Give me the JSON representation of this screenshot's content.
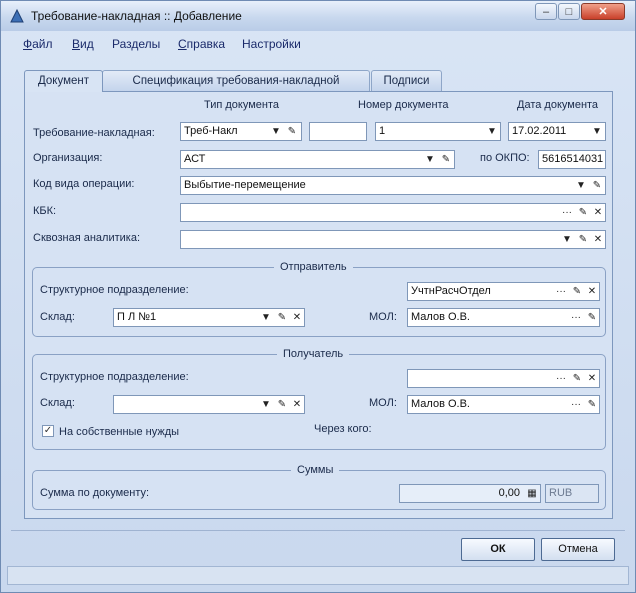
{
  "window": {
    "title": "Требование-накладная :: Добавление",
    "controls": {
      "minimize": "–",
      "maximize": "□",
      "close": "✕"
    }
  },
  "menu": {
    "items": [
      {
        "label": "Файл",
        "underline": "Ф",
        "rest": "айл"
      },
      {
        "label": "Вид",
        "underline": "В",
        "rest": "ид"
      },
      {
        "label": "Разделы",
        "underline": "",
        "rest": "Разделы"
      },
      {
        "label": "Справка",
        "underline": "С",
        "rest": "правка"
      },
      {
        "label": "Настройки",
        "underline": "",
        "rest": "Настройки"
      }
    ]
  },
  "tabs": [
    "Документ",
    "Спецификация требования-накладной",
    "Подписи"
  ],
  "header_cols": {
    "doc_type": "Тип документа",
    "doc_number": "Номер документа",
    "doc_date": "Дата документа"
  },
  "form": {
    "invoice_label": "Требование-накладная:",
    "doc_type_value": "Треб-Накл",
    "prefix_value": "",
    "number_value": "1",
    "date_value": "17.02.2011",
    "org_label": "Организация:",
    "org_value": "АСТ",
    "okpo_label": "по ОКПО:",
    "okpo_value": "5616514031",
    "op_label": "Код вида операции:",
    "op_value": "Выбытие-перемещение",
    "kbk_label": "КБК:",
    "kbk_value": "",
    "analytics_label": "Сквозная аналитика:",
    "analytics_value": ""
  },
  "sender": {
    "title": "Отправитель",
    "dept_label": "Структурное подразделение:",
    "dept_value": "УчтнРасчОтдел",
    "warehouse_label": "Склад:",
    "warehouse_value": "П Л №1",
    "mol_label": "МОЛ:",
    "mol_value": "Малов О.В."
  },
  "receiver": {
    "title": "Получатель",
    "dept_label": "Структурное подразделение:",
    "dept_value": "",
    "warehouse_label": "Склад:",
    "warehouse_value": "",
    "mol_label": "МОЛ:",
    "mol_value": "Малов О.В.",
    "own_needs_label": "На собственные нужды",
    "own_needs_checked": true,
    "via_label": "Через кого:"
  },
  "sums": {
    "title": "Суммы",
    "total_label": "Сумма по документу:",
    "total_value": "0,00",
    "currency": "RUB"
  },
  "buttons": {
    "ok": "ОК",
    "cancel": "Отмена"
  },
  "icons": {
    "dropdown": "▼",
    "select": "✎",
    "more": "···",
    "clear": "✕"
  }
}
